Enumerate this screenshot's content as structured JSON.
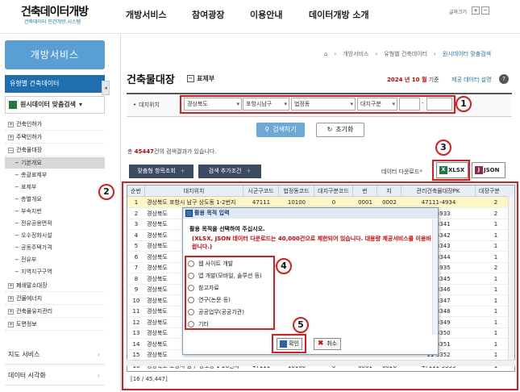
{
  "header": {
    "logo_main": "건축데이터개방",
    "logo_sub": "건축데이터 민간개방 시스템",
    "nav": [
      "개방서비스",
      "참여광장",
      "이용안내",
      "데이터개방 소개"
    ],
    "font_size_label": "글자크기",
    "font_plus": "+",
    "font_minus": "−"
  },
  "sidebar": {
    "title": "개방서비스",
    "category": "유형별 건축데이터",
    "collapse_glyph": "◂",
    "open_data_menu": "원시데이터 맞춤검색",
    "items": [
      {
        "pm": "+",
        "label": "건축인허가"
      },
      {
        "pm": "+",
        "label": "주택인허가"
      },
      {
        "pm": "−",
        "label": "건축물대장"
      }
    ],
    "sub_items": [
      "기본개요",
      "총괄표제부",
      "표제부",
      "층별개요",
      "부속지번",
      "전유공용면적",
      "오수정화시설",
      "공동주택가격",
      "전유부",
      "지역지구구역"
    ],
    "items_after": [
      {
        "pm": "+",
        "label": "폐쇄말소대장"
      },
      {
        "pm": "+",
        "label": "건물에너지"
      },
      {
        "pm": "+",
        "label": "건축물유지관리"
      },
      {
        "pm": "+",
        "label": "도면정보"
      }
    ],
    "bottom_menus": [
      "지도 서비스",
      "데이터 시각화"
    ],
    "bottom_arrow": "›"
  },
  "breadcrumb": [
    "⌂",
    "개방서비스",
    "유형별 건축데이터",
    "원시데이터 맞춤검색"
  ],
  "breadcrumb_sep": "›",
  "page": {
    "title": "건축물대장",
    "title_tag": "표제부",
    "ref_date_value": "2024 년 10 월",
    "ref_date_suffix": " 기준",
    "help_label": "제공 데이터 설명",
    "help_icon": "?"
  },
  "search": {
    "label": "대지위치",
    "sido": "경상북도",
    "sigungu": "포항시남구",
    "dong": "법정동",
    "land_type": "대지구분",
    "bun_value": "",
    "dash": "-",
    "ji_value": "",
    "search_button": "검색하기",
    "search_icon": "⚲",
    "reset_button": "초기화",
    "reset_icon": "↻"
  },
  "results": {
    "prefix": "총 ",
    "count": "45447",
    "suffix": "건의 검색결과가 있습니다.",
    "items_button": "맞춤형 항목조회",
    "items_plus": "+",
    "addcond_button": "검색 추가조건",
    "addcond_plus": "+",
    "download_label": "데이터 다운로드",
    "download_star": "*",
    "xlsx_button": "XLSX",
    "xlsx_icon": "X",
    "json_button": "JSON",
    "json_icon": "J"
  },
  "table": {
    "columns": [
      "순번",
      "대지위치",
      "시군구코드",
      "법정동코드",
      "대지구분코드",
      "번",
      "지",
      "관리건축물대장PK",
      "대장구분"
    ],
    "rows": [
      [
        "1",
        "경상북도 포항시 남구 상도동 1-2번지",
        "47111",
        "10100",
        "0",
        "0001",
        "0002",
        "47111-4934",
        "2"
      ],
      [
        "2",
        "경상북도",
        "",
        "",
        "",
        "",
        "",
        "11-4933",
        "2"
      ],
      [
        "3",
        "경상북도",
        "",
        "",
        "",
        "",
        "",
        "11-3341",
        "1"
      ],
      [
        "4",
        "경상북도",
        "",
        "",
        "",
        "",
        "",
        "11-3342",
        "1"
      ],
      [
        "5",
        "경상북도",
        "",
        "",
        "",
        "",
        "",
        "11-3343",
        "1"
      ],
      [
        "6",
        "경상북도",
        "",
        "",
        "",
        "",
        "",
        "11-3344",
        "1"
      ],
      [
        "7",
        "경상북도",
        "",
        "",
        "",
        "",
        "",
        "11-4935",
        "2"
      ],
      [
        "8",
        "경상북도",
        "",
        "",
        "",
        "",
        "",
        "11-3345",
        "1"
      ],
      [
        "9",
        "경상북도",
        "",
        "",
        "",
        "",
        "",
        "11-3346",
        "1"
      ],
      [
        "10",
        "경상북도",
        "",
        "",
        "",
        "",
        "",
        "11-3347",
        "1"
      ],
      [
        "11",
        "경상북도",
        "",
        "",
        "",
        "",
        "",
        "11-3348",
        "1"
      ],
      [
        "12",
        "경상북도",
        "",
        "",
        "",
        "",
        "",
        "11-3349",
        "1"
      ],
      [
        "13",
        "경상북도",
        "",
        "",
        "",
        "",
        "",
        "11-3350",
        "1"
      ],
      [
        "14",
        "경상북도",
        "",
        "",
        "",
        "",
        "",
        "11-3351",
        "1"
      ],
      [
        "15",
        "경상북도",
        "",
        "",
        "",
        "",
        "",
        "11-3352",
        "1"
      ],
      [
        "16",
        "경상북도 포항시 남구 상도동 1-26번지",
        "47111",
        "10100",
        "0",
        "0001",
        "0026",
        "47111-3353",
        "1"
      ]
    ],
    "footer": "[16 / 45,447]"
  },
  "dialog": {
    "title": "활용 목적 입력",
    "message": "활용 목적을 선택하여 주십시오.",
    "warning": "(XLSX, JSON 데이터 다운로드는 40,000건으로 제한되어 있습니다. 대용량 제공서비스를 이용바랍니다.)",
    "options": [
      "웹 사이트 개발",
      "앱 개발(모바일, 솔루션 등)",
      "참고자료",
      "연구(논문 등)",
      "공공업무(공공기관)",
      "기타"
    ],
    "confirm_button": "확인",
    "cancel_button": "취소",
    "cancel_icon": "✖"
  },
  "annotations": [
    "1",
    "2",
    "3",
    "4",
    "5"
  ],
  "colors": {
    "accent_blue": "#1f6fb0",
    "annotation_red": "#e21a1a",
    "dark_button": "#3d4a63",
    "highlight_row": "#fff6c8"
  }
}
